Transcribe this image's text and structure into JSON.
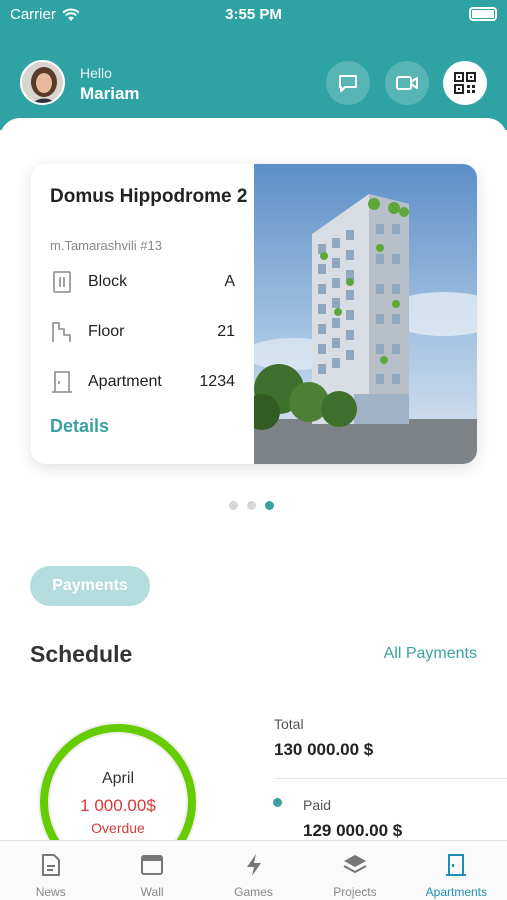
{
  "status_bar": {
    "carrier": "Carrier",
    "time": "3:55 PM"
  },
  "header": {
    "greeting": "Hello",
    "user_name": "Mariam"
  },
  "card": {
    "title": "Domus Hippodrome 2",
    "address": "m.Tamarashvili #13",
    "rows": [
      {
        "label": "Block",
        "value": "A",
        "icon": "block-icon"
      },
      {
        "label": "Floor",
        "value": "21",
        "icon": "stairs-icon"
      },
      {
        "label": "Apartment",
        "value": "1234",
        "icon": "door-icon"
      }
    ],
    "details_label": "Details"
  },
  "carousel": {
    "count": 3,
    "active_index": 2
  },
  "payments_pill": "Payments",
  "schedule": {
    "title": "Schedule",
    "all_payments": "All Payments",
    "month": "April",
    "amount": "1 000.00$",
    "status": "Overdue",
    "total_label": "Total",
    "total_value": "130 000.00 $",
    "paid_label": "Paid",
    "paid_value": "129 000.00 $"
  },
  "colors": {
    "accent": "#2fa3a3",
    "ring": "#66cc00",
    "overdue": "#d9383a",
    "active_tab": "#1f8fb0"
  },
  "tabbar": {
    "tabs": [
      {
        "label": "News",
        "icon": "news-icon"
      },
      {
        "label": "Wall",
        "icon": "wall-icon"
      },
      {
        "label": "Games",
        "icon": "lightning-icon"
      },
      {
        "label": "Projects",
        "icon": "layers-icon"
      },
      {
        "label": "Apartments",
        "icon": "door-icon"
      }
    ],
    "active": "Apartments"
  }
}
